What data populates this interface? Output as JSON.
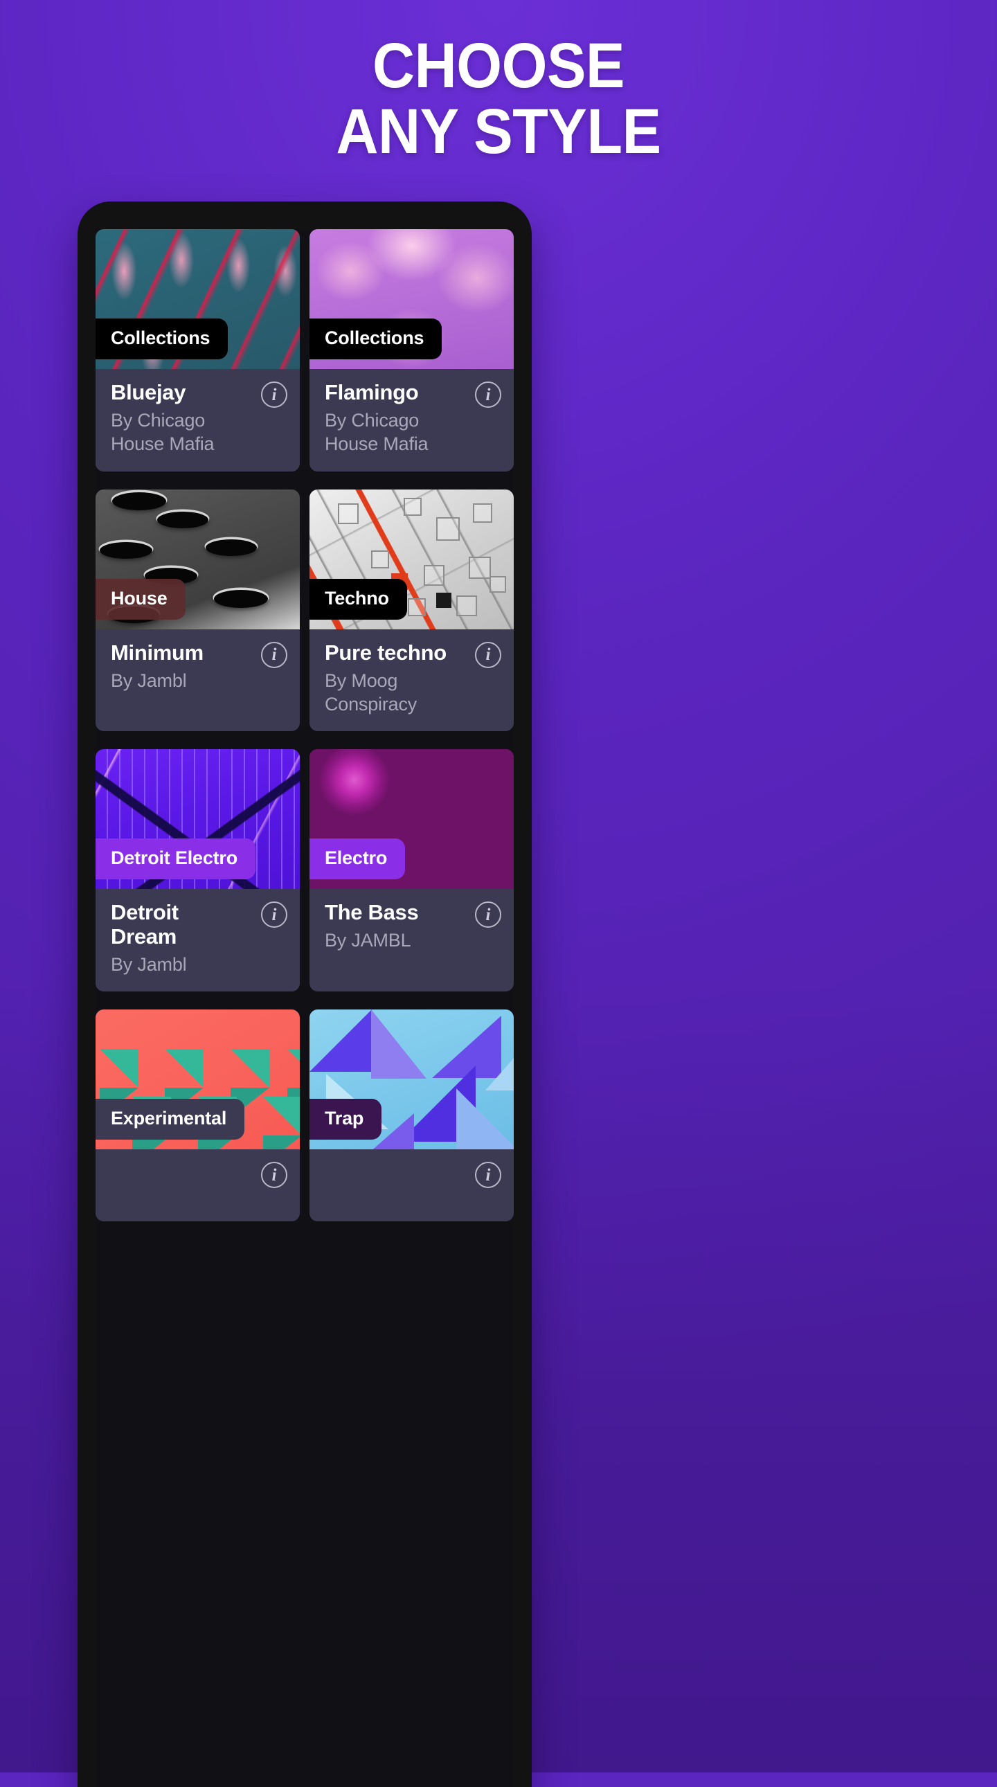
{
  "theme": {
    "background": "#5b25c0",
    "phone_frame": "#121212",
    "card_footer": "#3b3a52",
    "title_color": "#ffffff",
    "subtitle_color": "#a9a7b8",
    "info_icon_color": "#cfcddb"
  },
  "headline": {
    "line1": "CHOOSE",
    "line2": "ANY STYLE"
  },
  "info_icon_glyph": "i",
  "cards": [
    {
      "badge": "Collections",
      "badge_color": "#000000",
      "title": "Bluejay",
      "subtitle": "By Chicago House Mafia",
      "art": "art-bluejay",
      "info": "info-icon"
    },
    {
      "badge": "Collections",
      "badge_color": "#000000",
      "title": "Flamingo",
      "subtitle": "By Chicago House Mafia",
      "art": "art-flamingo",
      "info": "info-icon"
    },
    {
      "badge": "House",
      "badge_color": "#5c2d2d",
      "title": "Minimum",
      "subtitle": "By Jambl",
      "art": "art-minimum",
      "info": "info-icon"
    },
    {
      "badge": "Techno",
      "badge_color": "#000000",
      "title": "Pure techno",
      "subtitle": "By Moog Conspiracy",
      "art": "art-techno",
      "info": "info-icon"
    },
    {
      "badge": "Detroit Electro",
      "badge_color": "#8b2ee8",
      "title": "Detroit Dream",
      "subtitle": "By Jambl",
      "art": "art-detroit",
      "info": "info-icon"
    },
    {
      "badge": "Electro",
      "badge_color": "#8b2ee8",
      "title": "The Bass",
      "subtitle": "By JAMBL",
      "art": "art-bass",
      "info": "info-icon"
    },
    {
      "badge": "Experimental",
      "badge_color": "#3b3a52",
      "title": "",
      "subtitle": "",
      "art": "art-experimental",
      "info": "info-icon"
    },
    {
      "badge": "Trap",
      "badge_color": "#3a1550",
      "title": "",
      "subtitle": "",
      "art": "art-trap",
      "info": "info-icon"
    }
  ]
}
